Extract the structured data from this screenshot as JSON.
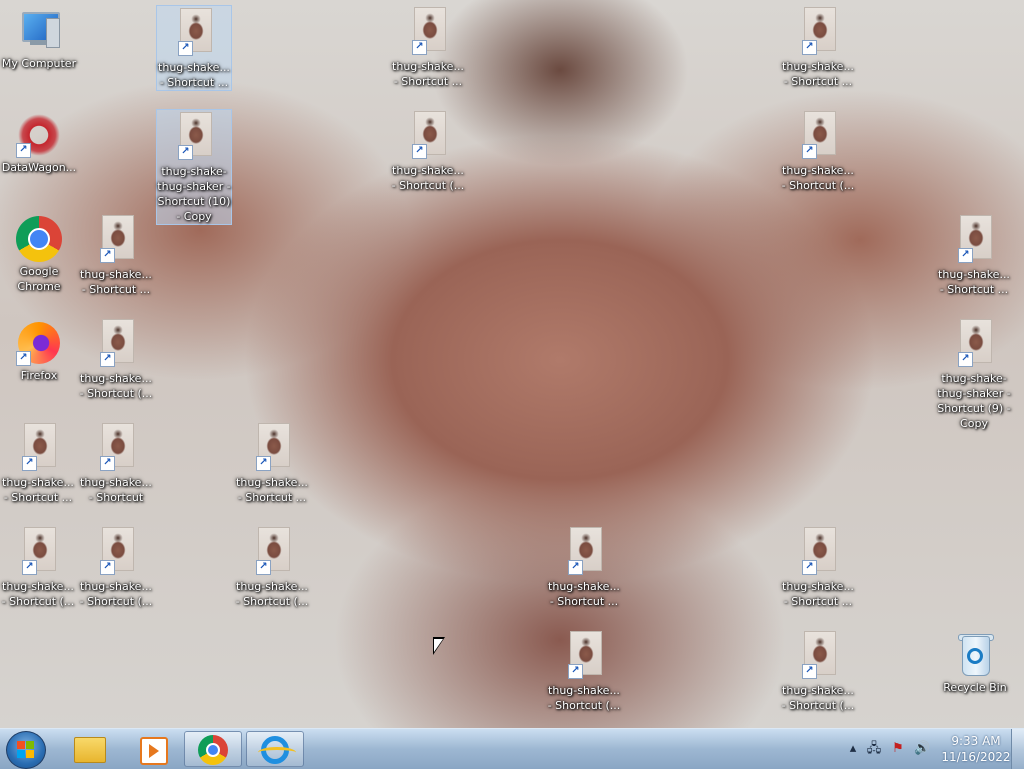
{
  "desktop": {
    "system_icons": {
      "my_computer": "My Computer",
      "datawagon": "DataWagon...",
      "chrome": "Google Chrome",
      "firefox": "Firefox",
      "recycle_bin": "Recycle Bin"
    },
    "shortcuts": [
      "thug-shake... - Shortcut ...",
      "thug-shake-thug-shaker - Shortcut (10) - Copy",
      "thug-shake... - Shortcut ...",
      "thug-shake... - Shortcut (...",
      "thug-shake... - Shortcut ...",
      "thug-shake... - Shortcut (...",
      "thug-shake... - Shortcut ...",
      "thug-shake... - Shortcut ...",
      "thug-shake... - Shortcut (...",
      "thug-shake-thug-shaker - Shortcut (9) - Copy",
      "thug-shake... - Shortcut ...",
      "thug-shake... - Shortcut",
      "thug-shake... - Shortcut ...",
      "thug-shake... - Shortcut (...",
      "thug-shake... - Shortcut (...",
      "thug-shake... - Shortcut (...",
      "thug-shake... - Shortcut ...",
      "thug-shake... - Shortcut ...",
      "thug-shake... - Shortcut (...",
      "thug-shake... - Shortcut (..."
    ]
  },
  "taskbar": {
    "pinned": [
      "windows-explorer",
      "media-player",
      "google-chrome",
      "internet-explorer"
    ],
    "clock": {
      "time": "9:33 AM",
      "date": "11/16/2022"
    }
  }
}
